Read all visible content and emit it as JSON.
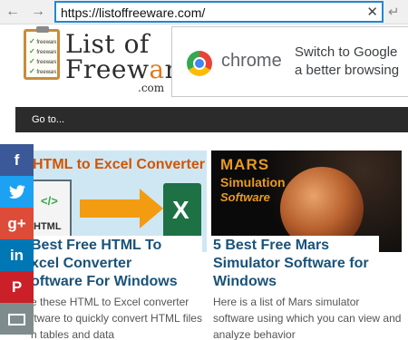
{
  "browser": {
    "url": "https://listoffreeware.com/",
    "back_glyph": "←",
    "forward_glyph": "→",
    "clear_glyph": "✕",
    "enter_glyph": "↵"
  },
  "logo": {
    "line1": "List of",
    "line2_part1": "Freew",
    "line2_highlight": "a",
    "line2_part2": "re",
    "domain": ".com",
    "clipboard_items": [
      "freeware",
      "freeware",
      "freeware",
      "freeware"
    ]
  },
  "ad": {
    "brand": "chrome",
    "text_line1": "Switch to Google",
    "text_line2": "a better browsing"
  },
  "nav": {
    "goto_label": "Go to..."
  },
  "articles": [
    {
      "thumb_title": "HTML to Excel Converter",
      "thumb_code": "</>",
      "thumb_doc_label": "HTML",
      "thumb_excel": "X",
      "title_line1": "Best Free HTML To",
      "title_line2": "xcel Converter",
      "title_line3": "oftware For Windows",
      "desc_line1": "e these HTML to Excel converter",
      "desc_line2": "ftware to quickly convert HTML files",
      "desc_line3": "h tables and data"
    },
    {
      "thumb_line1": "MARS",
      "thumb_line2": "Simulation",
      "thumb_line3": "Software",
      "title_line1": "5 Best Free Mars",
      "title_line2": "Simulator Software for",
      "title_line3": "Windows",
      "desc_line1": "Here is a list of Mars simulator",
      "desc_line2": "software using which you can view and",
      "desc_line3": "analyze behavior"
    }
  ],
  "social": [
    {
      "icon": "facebook-icon",
      "glyph": "f",
      "color": "#3b5998"
    },
    {
      "icon": "twitter-icon",
      "glyph": "🐦",
      "color": "#1da1f2"
    },
    {
      "icon": "google-plus-icon",
      "glyph": "g+",
      "color": "#dd4b39"
    },
    {
      "icon": "linkedin-icon",
      "glyph": "in",
      "color": "#0077b5"
    },
    {
      "icon": "pinterest-icon",
      "glyph": "P",
      "color": "#cb2027"
    },
    {
      "icon": "mail-icon",
      "glyph": "",
      "color": "#7f8c8d"
    }
  ]
}
